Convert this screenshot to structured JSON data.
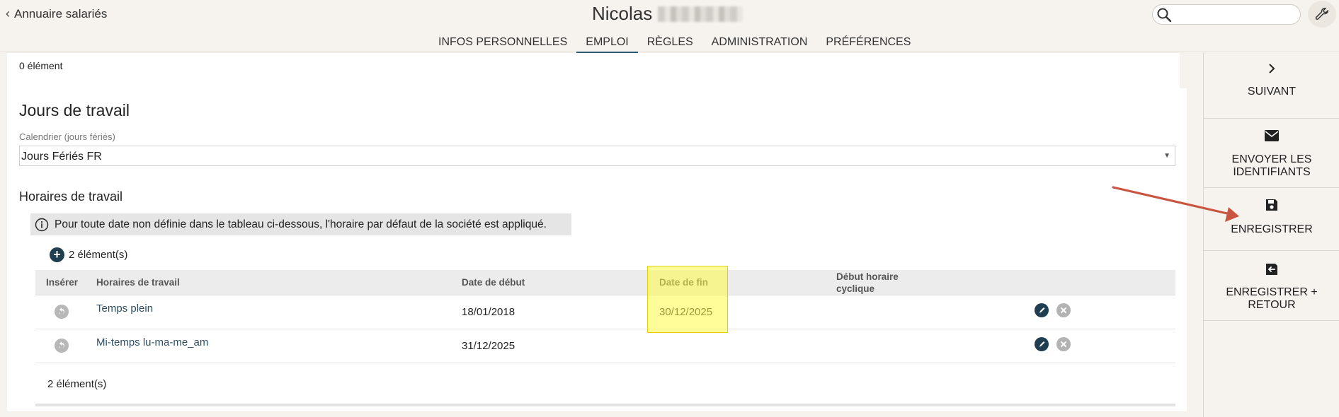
{
  "header": {
    "back_label": "Annuaire salariés",
    "employee_first_name": "Nicolas",
    "search_placeholder": ""
  },
  "tabs": [
    {
      "label": "INFOS PERSONNELLES",
      "active": false
    },
    {
      "label": "EMPLOI",
      "active": true
    },
    {
      "label": "RÈGLES",
      "active": false
    },
    {
      "label": "ADMINISTRATION",
      "active": false
    },
    {
      "label": "PRÉFÉRENCES",
      "active": false
    }
  ],
  "main": {
    "top_count": "0 élément",
    "section_title": "Jours de travail",
    "calendar_label": "Calendrier (jours fériés)",
    "calendar_value": "Jours Fériés FR",
    "schedules_title": "Horaires de travail",
    "info_text": "Pour toute date non définie dans le tableau ci-dessous, l'horaire par défaut de la société est appliqué.",
    "add_count": "2 élément(s)",
    "bottom_count": "2 élément(s)"
  },
  "table": {
    "columns": {
      "insert": "Insérer",
      "schedule": "Horaires de travail",
      "start": "Date de début",
      "end": "Date de fin",
      "cyclic_1": "Début horaire",
      "cyclic_2": "cyclique"
    },
    "rows": [
      {
        "schedule": "Temps plein",
        "start": "18/01/2018",
        "end": "30/12/2025",
        "cyclic": ""
      },
      {
        "schedule": "Mi-temps lu-ma-me_am",
        "start": "31/12/2025",
        "end": "",
        "cyclic": ""
      }
    ]
  },
  "actions": {
    "next": "SUIVANT",
    "send_1": "ENVOYER LES",
    "send_2": "IDENTIFIANTS",
    "save": "ENREGISTRER",
    "save_back_1": "ENREGISTRER +",
    "save_back_2": "RETOUR"
  },
  "colors": {
    "accent": "#2d5a73",
    "highlight": "#fffb46",
    "annotation_arrow": "#c9543f",
    "background": "#f6f3ee"
  }
}
